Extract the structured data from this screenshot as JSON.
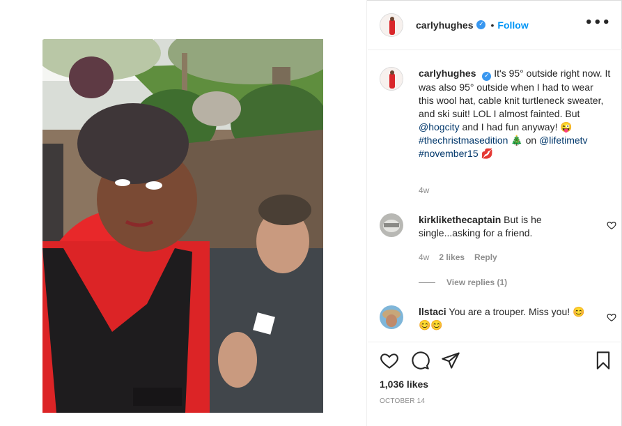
{
  "post": {
    "username": "carlyhughes",
    "verified_mark": "✓",
    "separator": "•",
    "follow_label": "Follow",
    "more_label": "•••"
  },
  "caption": {
    "username": "carlyhughes",
    "text_1": "It's 95° outside right now. It was also 95° outside when I had to wear this wool hat, cable knit turtleneck sweater, and ski suit! LOL I almost fainted. But ",
    "mention_1": "@hogcity",
    "text_2": " and I had fun anyway! 😜 ",
    "hashtag_1": "#thechristmasedition",
    "text_3": " 🎄 on ",
    "mention_2": "@lifetimetv",
    "hashtag_2": "#november15",
    "text_4": " 💋",
    "time": "4w"
  },
  "comments": [
    {
      "username": "kirklikethecaptain",
      "text": "But is he single...asking for a friend.",
      "time": "4w",
      "likes": "2 likes",
      "reply_label": "Reply",
      "view_replies": "View replies (1)"
    },
    {
      "username": "llstaci",
      "text": "You are a trouper. Miss you! 😊😊😊"
    }
  ],
  "footer": {
    "likes": "1,036 likes",
    "date": "OCTOBER 14"
  },
  "icons": {
    "like": "heart-icon",
    "comment": "comment-icon",
    "share": "share-icon",
    "save": "bookmark-icon",
    "more": "more-options-icon"
  },
  "colors": {
    "link": "#00376b",
    "follow": "#0095f6",
    "verified": "#3897f0",
    "muted": "#8e8e8e",
    "border": "#efefef"
  }
}
